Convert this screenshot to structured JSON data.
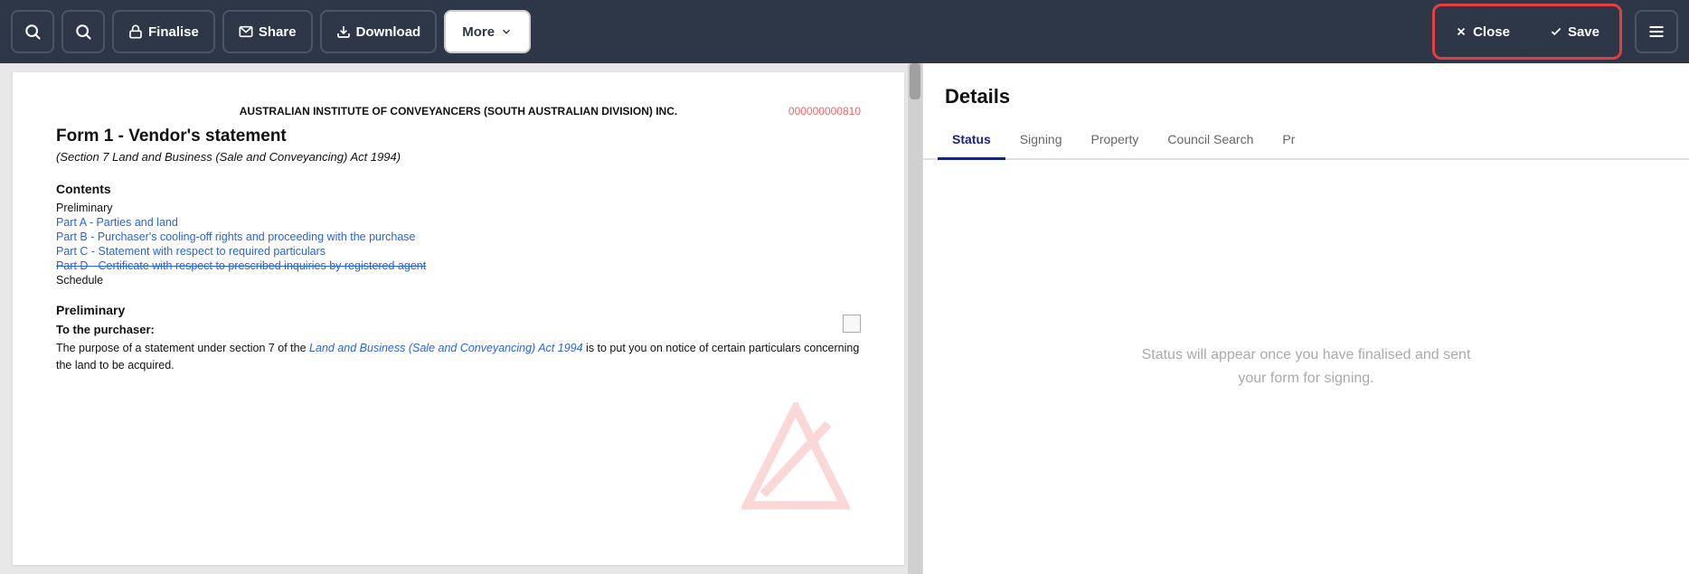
{
  "toolbar": {
    "search1_icon": "search",
    "search2_icon": "search",
    "finalise_label": "Finalise",
    "share_label": "Share",
    "download_label": "Download",
    "more_label": "More",
    "close_label": "Close",
    "save_label": "Save"
  },
  "document": {
    "header": "AUSTRALIAN INSTITUTE OF CONVEYANCERS (SOUTH AUSTRALIAN DIVISION) INC.",
    "ref": "000000000810",
    "title": "Form 1 - Vendor's statement",
    "subtitle": "(Section 7 Land and Business (Sale and Conveyancing) Act 1994)",
    "contents_title": "Contents",
    "contents_items": [
      {
        "text": "Preliminary",
        "style": "black"
      },
      {
        "text": "Part A - Parties and land",
        "style": "link"
      },
      {
        "text": "Part B - Purchaser's cooling-off rights and proceeding with the purchase",
        "style": "link"
      },
      {
        "text": "Part C - Statement with respect to required particulars",
        "style": "link"
      },
      {
        "text": "Part D - Certificate with respect to prescribed inquiries by registered agent",
        "style": "strikethrough"
      },
      {
        "text": "Schedule",
        "style": "black"
      }
    ],
    "preliminary_title": "Preliminary",
    "purchaser_label": "To the purchaser:",
    "body_text_1": "The purpose of a statement under section 7 of the ",
    "body_link": "Land and Business (Sale and Conveyancing) Act 1994",
    "body_text_2": " is to put you on notice of certain particulars concerning the land to be acquired."
  },
  "details": {
    "title": "Details",
    "tabs": [
      {
        "label": "Status",
        "active": true
      },
      {
        "label": "Signing",
        "active": false
      },
      {
        "label": "Property",
        "active": false
      },
      {
        "label": "Council Search",
        "active": false
      },
      {
        "label": "Pr...",
        "active": false,
        "partial": true
      }
    ],
    "status_message": "Status will appear once you have finalised and sent\nyour form for signing."
  }
}
